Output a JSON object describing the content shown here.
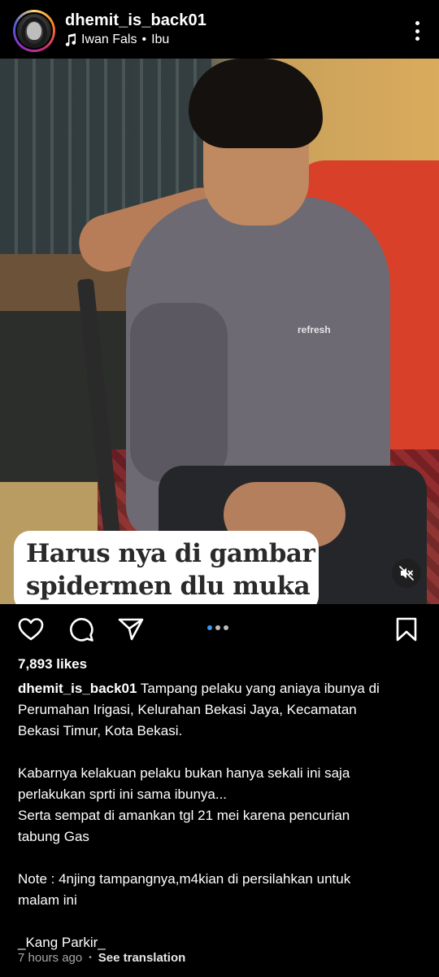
{
  "header": {
    "username": "dhemit_is_back01",
    "music_artist": "Iwan Fals",
    "music_separator": "•",
    "music_track": "Ibu"
  },
  "post": {
    "image_print": "refresh",
    "image_caption_line1": "Harus nya di gambar",
    "image_caption_line2": "spidermen dlu muka",
    "carousel_index": 1,
    "carousel_count": 3
  },
  "engagement": {
    "likes": "7,893 likes"
  },
  "caption": {
    "username": "dhemit_is_back01",
    "first_line": " Tampang pelaku yang aniaya ibunya di",
    "lines_block1": [
      "Perumahan Irigasi, Kelurahan Bekasi Jaya, Kecamatan",
      "Bekasi Timur, Kota Bekasi."
    ],
    "lines_block2": [
      "Kabarnya kelakuan pelaku bukan hanya sekali ini saja",
      "perlakukan sprti ini sama ibunya...",
      "Serta sempat di amankan tgl 21 mei karena pencurian",
      "tabung Gas"
    ],
    "lines_block3": [
      "Note : 4njing tampangnya,m4kian di persilahkan untuk",
      "malam ini"
    ],
    "signature": "_Kang Parkir_"
  },
  "meta": {
    "time": "7 hours ago",
    "separator": "•",
    "translate": "See translation"
  },
  "icons": {
    "like": "heart-icon",
    "comment": "comment-bubble-icon",
    "share": "paper-plane-icon",
    "save": "bookmark-icon",
    "music": "music-note-icon",
    "mute": "speaker-muted-icon",
    "more": "more-vertical-icon"
  },
  "colors": {
    "background": "#000000",
    "text": "#ffffff",
    "muted_text": "#a8a8a8",
    "carousel_active": "#3897f0"
  }
}
